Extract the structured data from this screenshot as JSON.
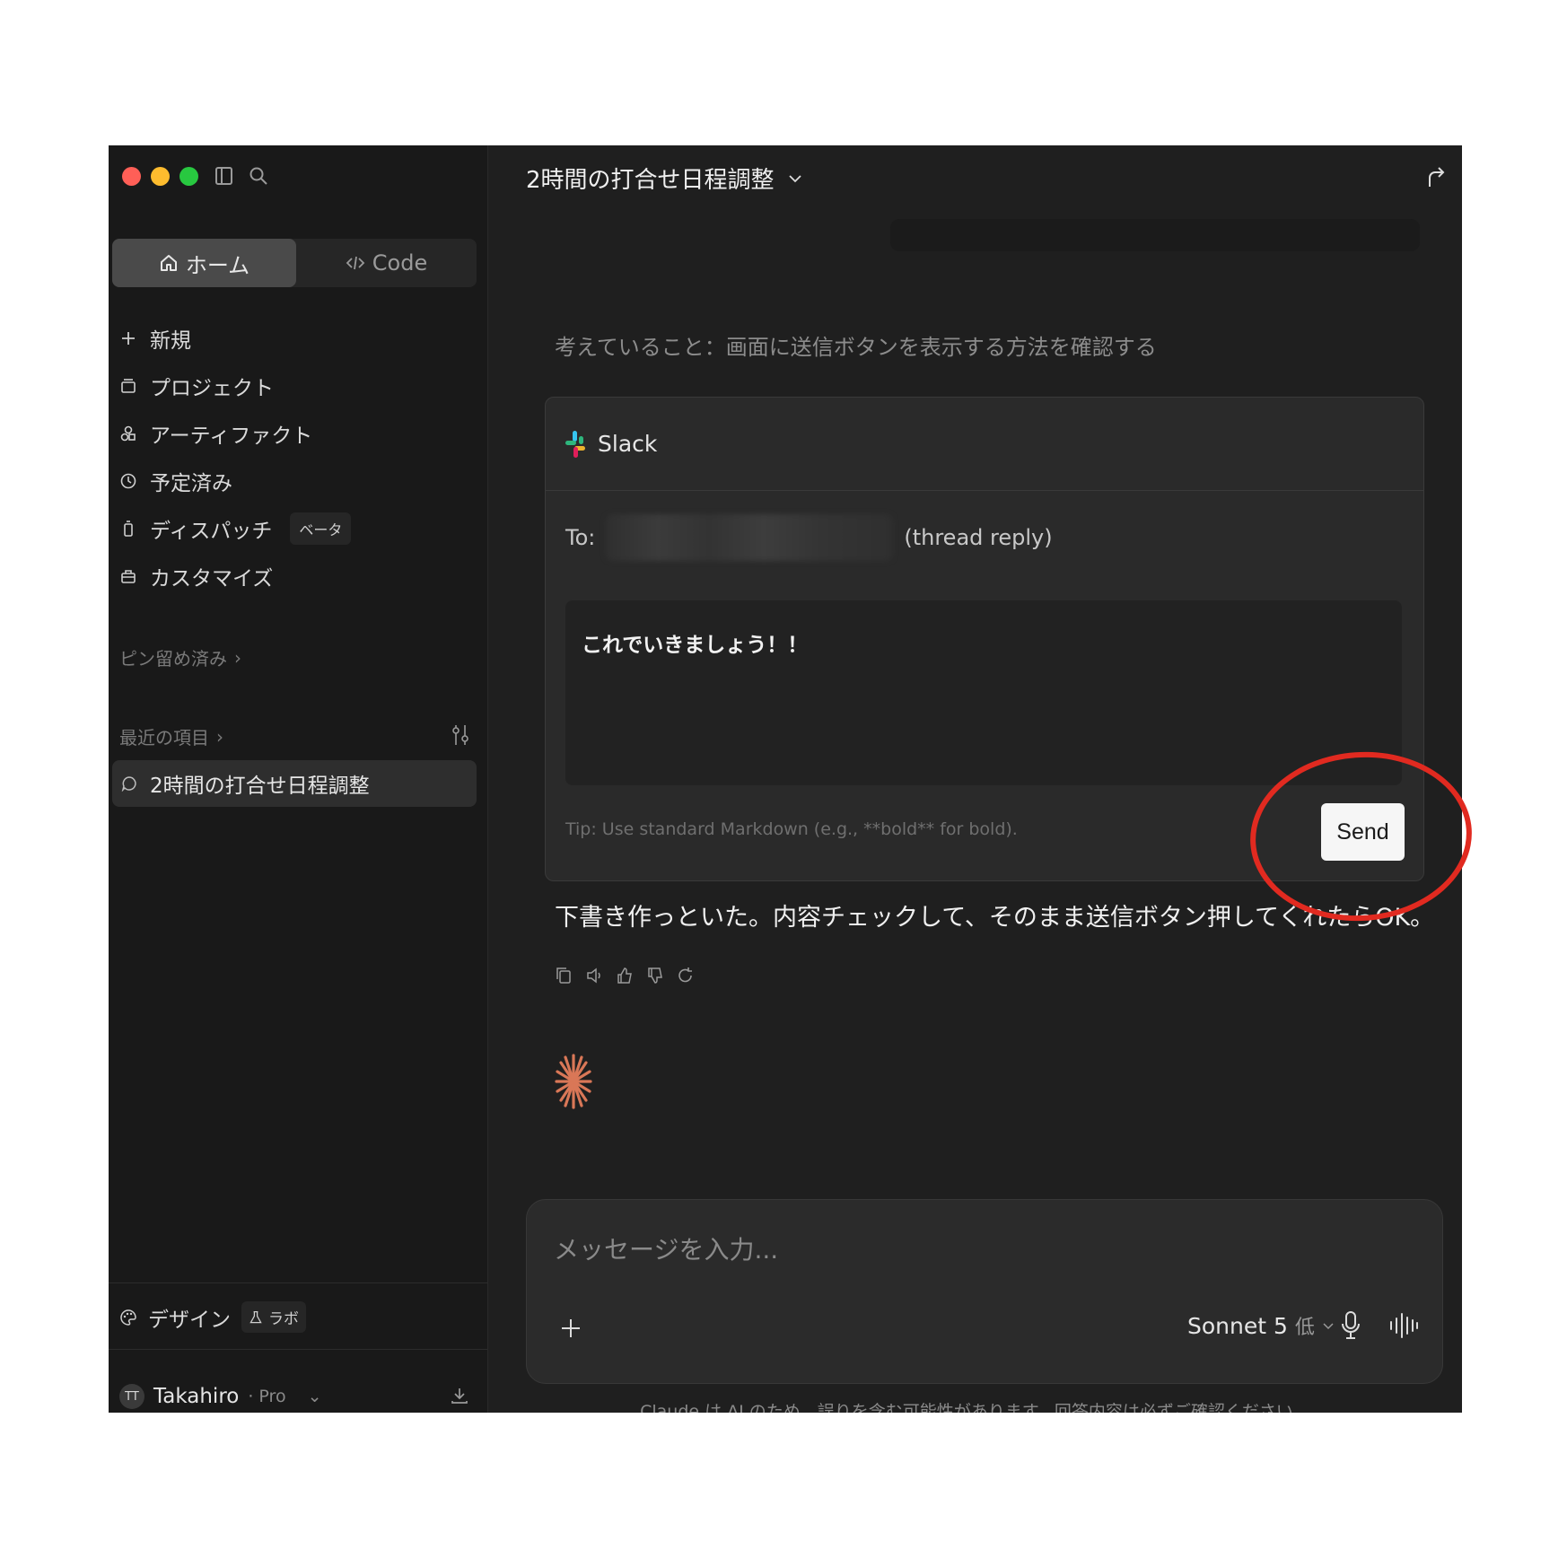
{
  "window": {
    "title": "2時間の打合せ日程調整",
    "traffic_colors": [
      "#ff5f57",
      "#febc2e",
      "#28c840"
    ]
  },
  "sidebar": {
    "tabs": [
      {
        "label": "ホーム",
        "icon": "home-icon",
        "active": true
      },
      {
        "label": "Code",
        "icon": "code-icon",
        "active": false
      }
    ],
    "nav": [
      {
        "label": "新規",
        "icon": "plus-icon"
      },
      {
        "label": "プロジェクト",
        "icon": "folder-icon"
      },
      {
        "label": "アーティファクト",
        "icon": "artifacts-icon"
      },
      {
        "label": "予定済み",
        "icon": "clock-icon"
      },
      {
        "label": "ディスパッチ",
        "icon": "dispatch-icon",
        "badge": "ベータ"
      },
      {
        "label": "カスタマイズ",
        "icon": "briefcase-icon"
      }
    ],
    "pinned_label": "ピン留め済み",
    "recent_label": "最近の項目",
    "recent_items": [
      "2時間の打合せ日程調整"
    ],
    "design_label": "デザイン",
    "lab_badge": "ラボ",
    "user": {
      "initials": "TT",
      "name": "Takahiro",
      "plan": "· Pro"
    }
  },
  "main": {
    "thinking": "考えていること：画面に送信ボタンを表示する方法を確認する",
    "slack": {
      "app_name": "Slack",
      "to_label": "To:",
      "thread_reply": "(thread reply)",
      "message": "これでいきましょう！！",
      "tip": "Tip: Use standard Markdown (e.g., **bold** for bold).",
      "send_label": "Send"
    },
    "reply": "下書き作っといた。内容チェックして、そのまま送信ボタン押してくれたらOK。",
    "composer": {
      "placeholder": "メッセージを入力...",
      "model": "Sonnet 5",
      "effort": "低"
    },
    "disclaimer": "Claude は AI のため、誤りを含む可能性があります。回答内容は必ずご確認ください。"
  },
  "colors": {
    "accent_red": "#e12a20",
    "spark": "#d97757"
  }
}
